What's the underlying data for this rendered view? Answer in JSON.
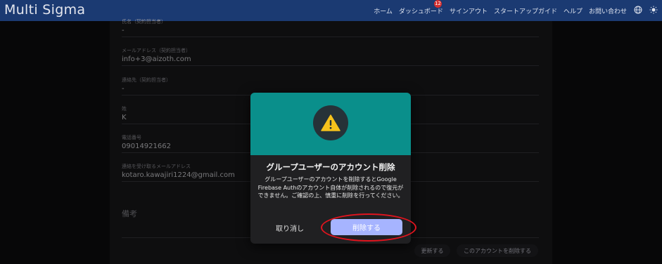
{
  "header": {
    "brand": "Multi Sigma",
    "nav": {
      "home": "ホーム",
      "dashboard": "ダッシュボード",
      "signout": "サインアウト",
      "startup_guide": "スタートアップガイド",
      "help": "ヘルプ",
      "contact": "お問い合わせ"
    },
    "notification_count": "12",
    "icons": [
      "globe-icon",
      "sun-icon"
    ]
  },
  "form": {
    "fields": [
      {
        "label": "氏名（契約担当者）",
        "value": "-"
      },
      {
        "label": "メールアドレス（契約担当者）",
        "value": "info+3@aizoth.com"
      },
      {
        "label": "連絡先（契約担当者）",
        "value": "-"
      },
      {
        "label": "姓",
        "value": "K"
      },
      {
        "label": "電話番号",
        "value": "09014921662"
      },
      {
        "label": "連絡を受け取るメールアドレス",
        "value": "kotaro.kawajiri1224@gmail.com"
      }
    ],
    "notes_label": "備考",
    "update_button": "更新する",
    "delete_account_button": "このアカウントを削除する"
  },
  "dialog": {
    "title": "グループユーザーのアカウント削除",
    "body": "グループユーザーのアカウントを削除するとGoogle Firebase Authのアカウント自体が削除されるので復元ができません。ご確認の上、慎重に削除を行ってください。",
    "cancel": "取り消し",
    "confirm": "削除する"
  },
  "colors": {
    "header_bg": "#1b3a72",
    "dialog_accent": "#0a8f8b",
    "confirm_button": "#a6b4ff",
    "warning_icon": "#f6c21c",
    "badge": "#d32f2f",
    "annotation": "#e0141e"
  }
}
